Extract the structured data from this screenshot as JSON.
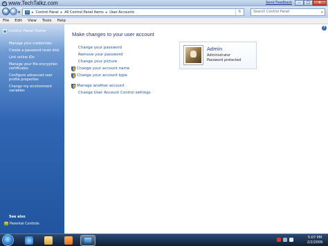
{
  "watermark": "www.TechTalkz.com",
  "titlebar": {
    "send_feedback": "Send Feedback",
    "minimize": "–",
    "maximize": "□",
    "close": "x"
  },
  "address": {
    "crumbs": [
      "Control Panel",
      "All Control Panel Items",
      "User Accounts"
    ],
    "separator": "▸",
    "search_placeholder": "Search Control Panel"
  },
  "menu": [
    "File",
    "Edit",
    "View",
    "Tools",
    "Help"
  ],
  "left_panel": {
    "home": "Control Panel Home",
    "links": [
      "Manage your credentials",
      "Create a password reset disk",
      "Link online IDs",
      "Manage your file encryption certificates",
      "Configure advanced user profile properties",
      "Change my environment variables"
    ],
    "see_also": "See also",
    "parental_controls": "Parental Controls"
  },
  "main": {
    "heading": "Make changes to your user account",
    "help": "?",
    "actions": [
      "Change your password",
      "Remove your password",
      "Change your picture",
      "Change your account name",
      "Change your account type"
    ],
    "other_actions": [
      "Manage another account",
      "Change User Account Control settings"
    ]
  },
  "user": {
    "name": "Admin",
    "role": "Administrator",
    "status": "Password protected"
  },
  "taskbar": {
    "time": "5:07 PM",
    "date": "2/2/2009"
  }
}
